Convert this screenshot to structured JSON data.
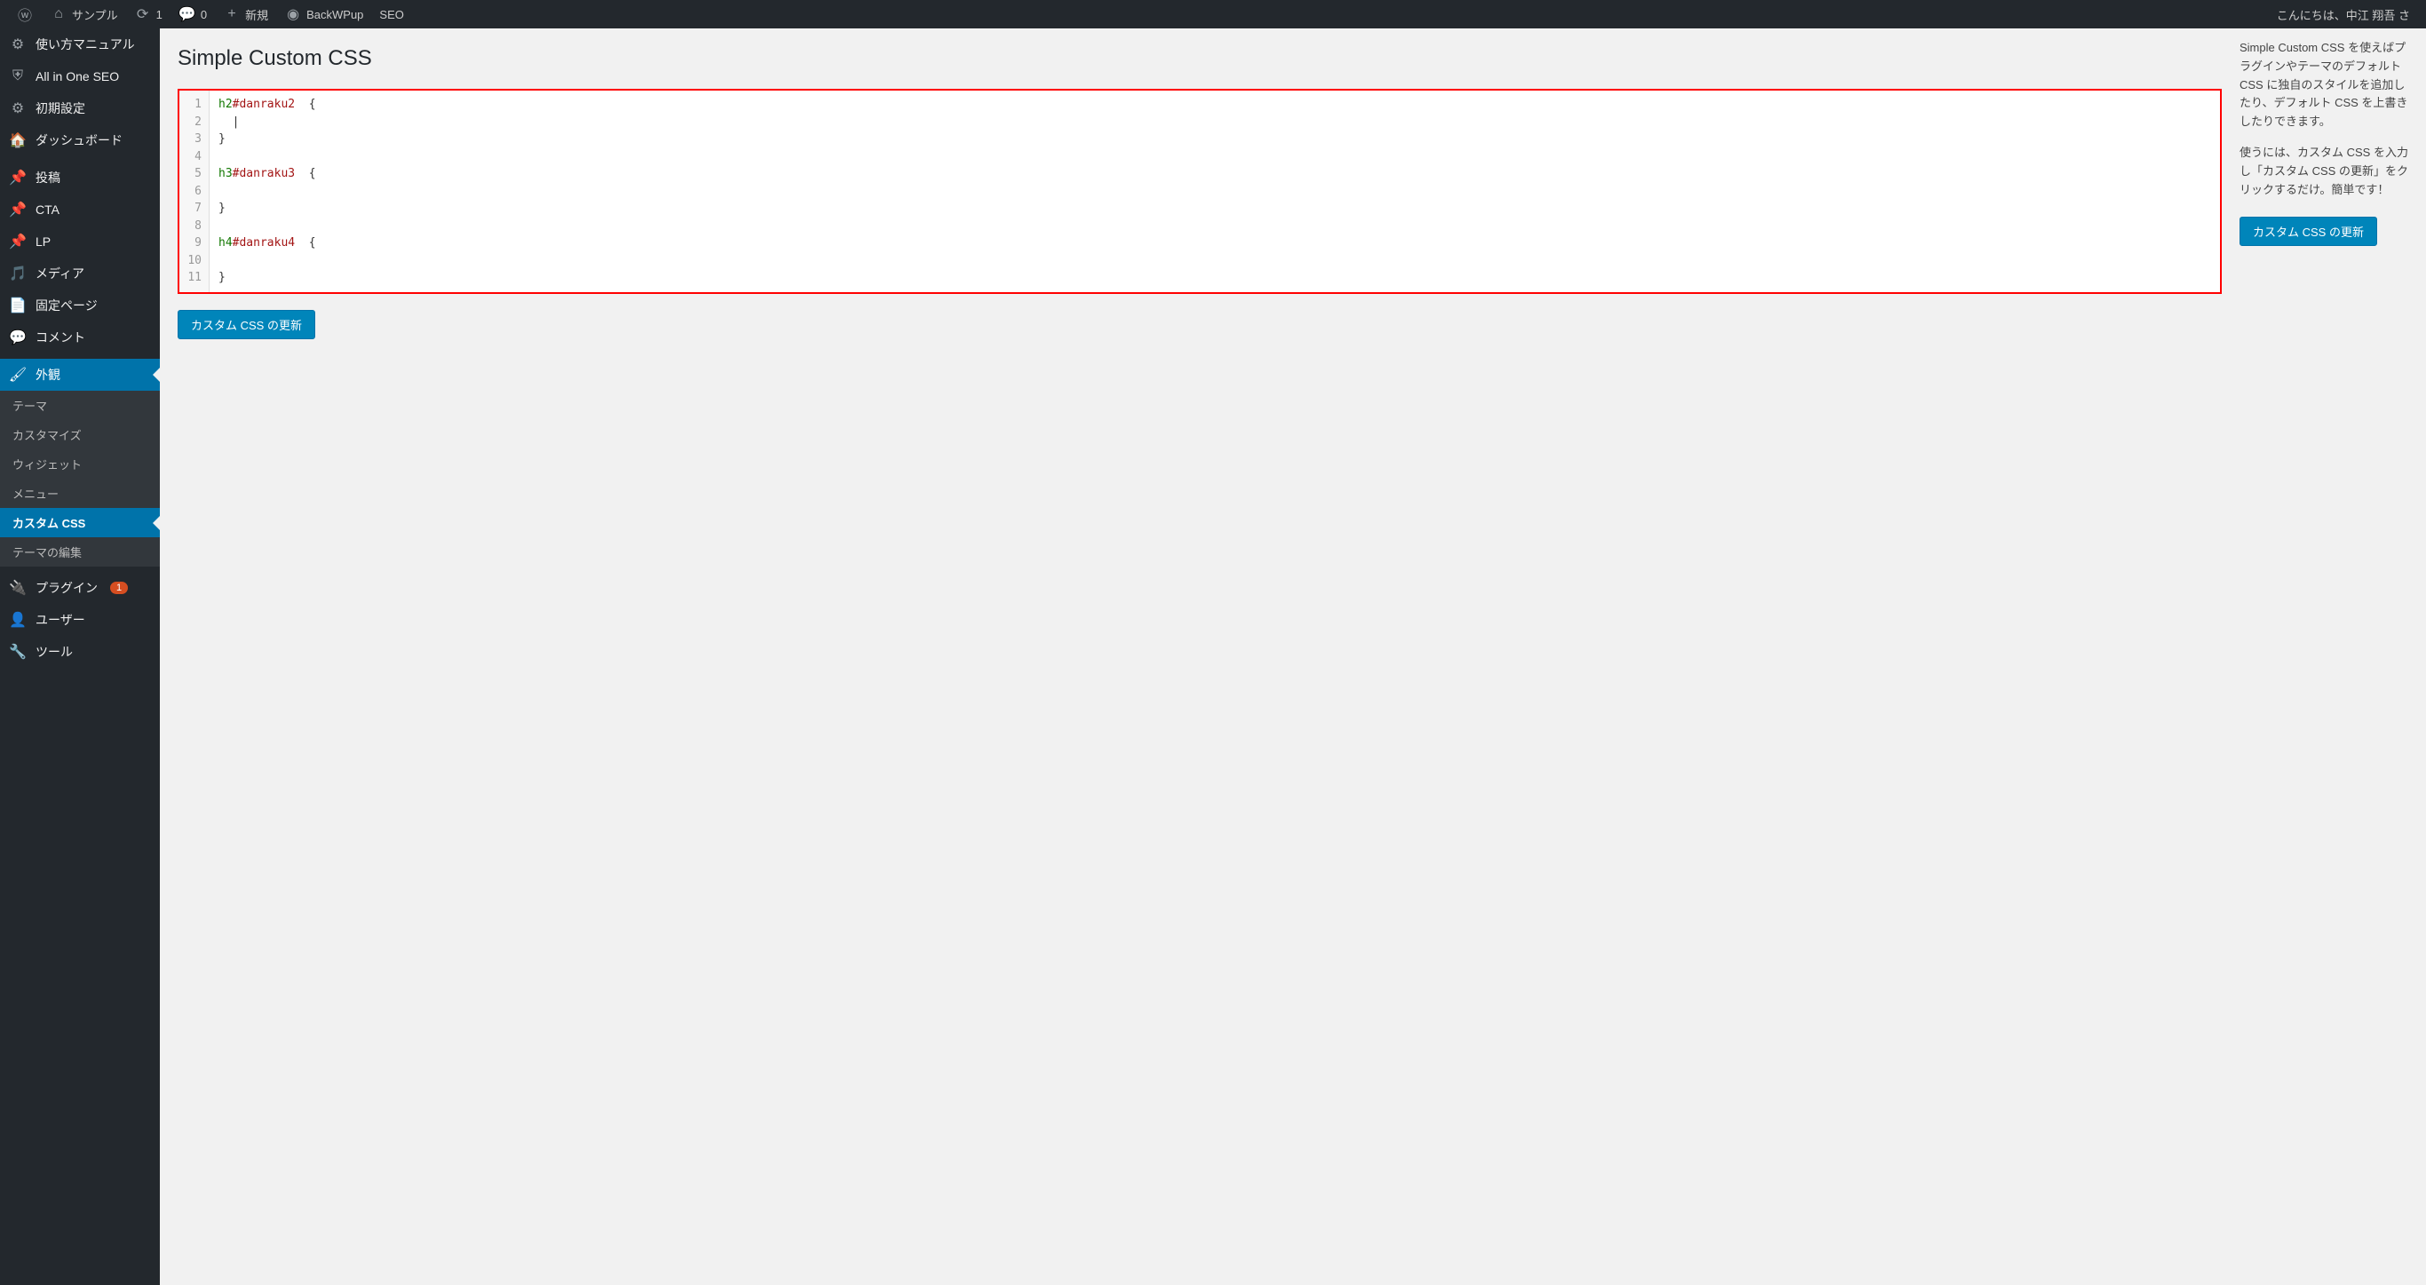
{
  "topbar": {
    "site": "サンプル",
    "updates": "1",
    "comments": "0",
    "new": "新規",
    "backwpup": "BackWPup",
    "seo": "SEO",
    "greeting": "こんにちは、中江 翔吾 さ"
  },
  "sidebar": {
    "manual": "使い方マニュアル",
    "aioseo": "All in One SEO",
    "initial": "初期設定",
    "dashboard": "ダッシュボード",
    "posts": "投稿",
    "cta": "CTA",
    "lp": "LP",
    "media": "メディア",
    "pages": "固定ページ",
    "comments": "コメント",
    "appearance": "外観",
    "sub_theme": "テーマ",
    "sub_customize": "カスタマイズ",
    "sub_widgets": "ウィジェット",
    "sub_menu": "メニュー",
    "sub_customcss": "カスタム CSS",
    "sub_themeedit": "テーマの編集",
    "plugins": "プラグイン",
    "plugins_count": "1",
    "users": "ユーザー",
    "tools": "ツール"
  },
  "page": {
    "title": "Simple Custom CSS",
    "update_btn": "カスタム CSS の更新"
  },
  "editor": {
    "lines": [
      {
        "n": "1",
        "t": "h2",
        "s": "#danraku2",
        "b": "  {"
      },
      {
        "n": "2",
        "t": "",
        "s": "",
        "b": "  |"
      },
      {
        "n": "3",
        "t": "",
        "s": "",
        "b": "}"
      },
      {
        "n": "4",
        "t": "",
        "s": "",
        "b": ""
      },
      {
        "n": "5",
        "t": "h3",
        "s": "#danraku3",
        "b": "  {"
      },
      {
        "n": "6",
        "t": "",
        "s": "",
        "b": ""
      },
      {
        "n": "7",
        "t": "",
        "s": "",
        "b": "}"
      },
      {
        "n": "8",
        "t": "",
        "s": "",
        "b": ""
      },
      {
        "n": "9",
        "t": "h4",
        "s": "#danraku4",
        "b": "  {"
      },
      {
        "n": "10",
        "t": "",
        "s": "",
        "b": ""
      },
      {
        "n": "11",
        "t": "",
        "s": "",
        "b": "}"
      }
    ]
  },
  "sidebar_right": {
    "p1": "Simple Custom CSS を使えばプラグインやテーマのデフォルト CSS に独自のスタイルを追加したり、デフォルト CSS を上書きしたりできます。",
    "p2": "使うには、カスタム CSS を入力し「カスタム CSS の更新」をクリックするだけ。簡単です！",
    "btn": "カスタム CSS の更新"
  }
}
